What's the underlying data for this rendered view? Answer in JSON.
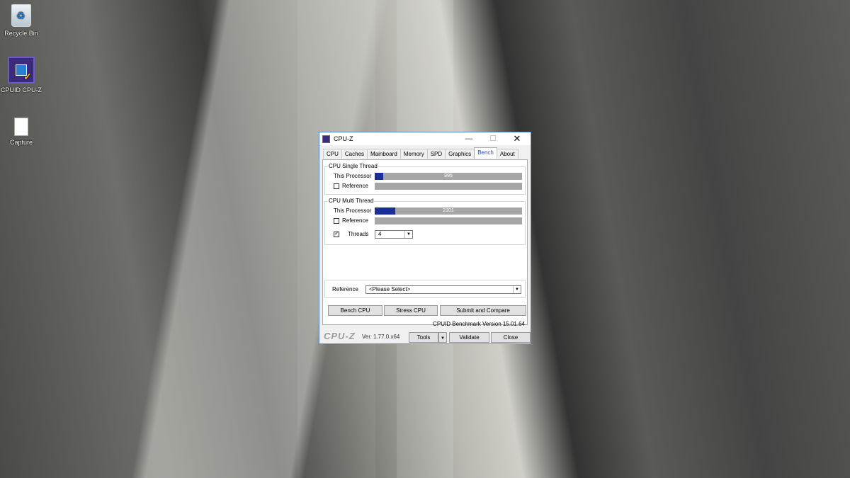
{
  "desktop": {
    "icons": [
      {
        "label": "Recycle Bin"
      },
      {
        "label": "CPUID CPU-Z"
      },
      {
        "label": "Capture"
      }
    ]
  },
  "window": {
    "title": "CPU-Z",
    "controls": {
      "minimize": "—",
      "maximize": "☐",
      "close": "✕"
    }
  },
  "tabs": [
    "CPU",
    "Caches",
    "Mainboard",
    "Memory",
    "SPD",
    "Graphics",
    "Bench",
    "About"
  ],
  "active_tab": "Bench",
  "single_thread": {
    "title": "CPU Single Thread",
    "this_processor_label": "This Processor",
    "this_processor_value": "995",
    "this_processor_fraction": 0.06,
    "reference_label": "Reference",
    "reference_checked": false
  },
  "multi_thread": {
    "title": "CPU Multi Thread",
    "this_processor_label": "This Processor",
    "this_processor_value": "2101",
    "this_processor_fraction": 0.14,
    "reference_label": "Reference",
    "reference_checked": false,
    "threads_label": "Threads",
    "threads_checked": true,
    "threads_value": "4"
  },
  "reference_select": {
    "label": "Reference",
    "value": "<Please Select>"
  },
  "buttons": {
    "bench_cpu": "Bench CPU",
    "stress_cpu": "Stress CPU",
    "submit_compare": "Submit and Compare"
  },
  "bench_version": "CPUID Benchmark Version 15.01.64",
  "footer": {
    "logo": "CPU-Z",
    "version": "Ver. 1.77.0.x64",
    "tools": "Tools",
    "validate": "Validate",
    "close": "Close"
  },
  "colors": {
    "bar_fill": "#1a2e9b",
    "bar_track": "#a6a6a6",
    "active_tab_text": "#2246c8",
    "window_border": "#5b8bd6"
  }
}
